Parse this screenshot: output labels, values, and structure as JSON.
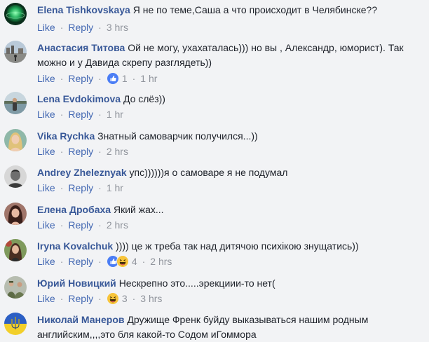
{
  "actions": {
    "like": "Like",
    "reply": "Reply",
    "separator": "·"
  },
  "comments": [
    {
      "author": "Elena Tishkovskaya",
      "text": "Я не по теме,Саша а что происходит в Челябинске??",
      "time": "3 hrs",
      "avatar": "green-sphere-avatar"
    },
    {
      "author": "Анастасия Титова",
      "text": "Ой не могу, ухахаталась))) но вы , Александр, юморист). Так можно и у Давида скрепу разглядеть))",
      "time": "1 hr",
      "reaction_count": "1",
      "reactions": [
        "like-reaction-icon"
      ],
      "avatar": "city-square-avatar"
    },
    {
      "author": "Lena Evdokimova",
      "text": "До слёз))",
      "time": "1 hr",
      "avatar": "seaside-avatar"
    },
    {
      "author": "Vika Rychka",
      "text": "Знатный самоварчик получился...))",
      "time": "2 hrs",
      "avatar": "blonde-portrait-avatar"
    },
    {
      "author": "Andrey Zheleznyak",
      "text": "упс))))))я о самоваре я не подумал",
      "time": "1 hr",
      "avatar": "bw-portrait-avatar"
    },
    {
      "author": "Елена Дробаха",
      "text": "Який жах...",
      "time": "2 hrs",
      "avatar": "dark-hair-portrait-avatar"
    },
    {
      "author": "Iryna Kovalchuk",
      "text": ")))) це ж треба так над дитячою психікою знущатись))",
      "time": "2 hrs",
      "reaction_count": "4",
      "reactions": [
        "like-reaction-icon",
        "haha-reaction-icon"
      ],
      "avatar": "outdoor-portrait-avatar"
    },
    {
      "author": "Юрий Новицкий",
      "text": "Нескрепно это.....эрекциии-то нет(",
      "time": "3 hrs",
      "reaction_count": "3",
      "reactions": [
        "haha-reaction-icon"
      ],
      "avatar": "soldiers-avatar"
    },
    {
      "author": "Николай Манеров",
      "text": "Дружище Френк буйду выказываться нашим родным английским,,,,это бля какой-то Содом иГоммора",
      "time": "",
      "avatar": "trident-emblem-avatar"
    }
  ],
  "colors": {
    "background": "#f2f3f5",
    "name": "#385898",
    "link": "#4267b2",
    "meta": "#90949c",
    "text": "#1d2129",
    "like_reaction": "#4a7df5",
    "haha_reaction": "#f7c43a"
  }
}
